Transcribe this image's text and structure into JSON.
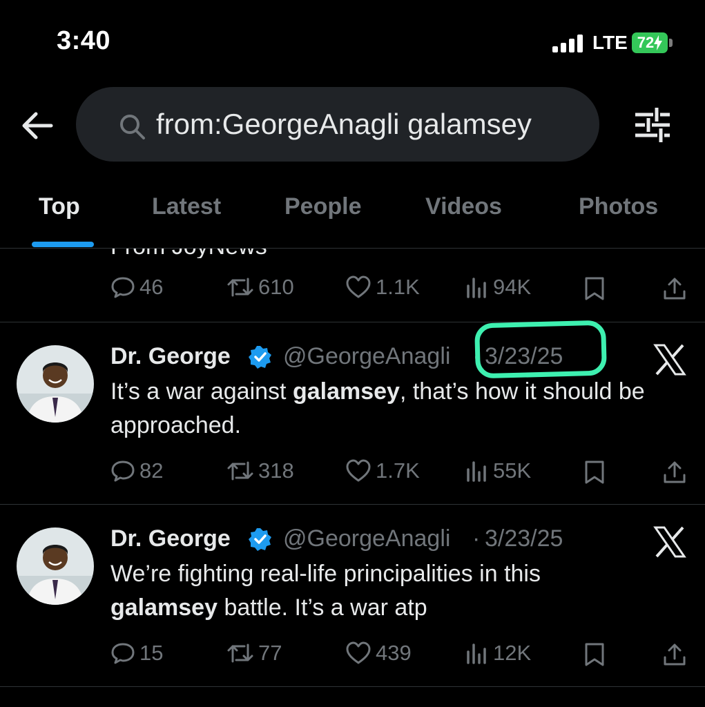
{
  "status_bar": {
    "time": "3:40",
    "network": "LTE",
    "battery": "72"
  },
  "header": {
    "back_icon": "arrow-left-icon",
    "search": {
      "icon": "search-icon",
      "query": "from:GeorgeAnagli galamsey"
    },
    "filter_icon": "sliders-icon"
  },
  "tabs": [
    {
      "label": "Top",
      "active": true
    },
    {
      "label": "Latest"
    },
    {
      "label": "People"
    },
    {
      "label": "Videos"
    },
    {
      "label": "Photos"
    }
  ],
  "prev_tweet": {
    "clipped_text": "From JoyNews",
    "stats": {
      "replies": "46",
      "reposts": "610",
      "likes": "1.1K",
      "views": "94K"
    }
  },
  "tweets": [
    {
      "name": "Dr. George",
      "handle": "@GeorgeAnagli",
      "separator": "·",
      "date": "3/23/25",
      "text_parts": [
        "It’s a war against ",
        "galamsey",
        ", that’s how it should be approached."
      ],
      "stats": {
        "replies": "82",
        "reposts": "318",
        "likes": "1.7K",
        "views": "55K"
      }
    },
    {
      "name": "Dr. George",
      "handle": "@GeorgeAnagli",
      "separator": "·",
      "date": "3/23/25",
      "text_parts": [
        "We’re fighting real-life principalities in this ",
        "galamsey",
        " battle. It’s a war atp"
      ],
      "stats": {
        "replies": "15",
        "reposts": "77",
        "likes": "439",
        "views": "12K"
      }
    }
  ],
  "colors": {
    "accent": "#1d9bf0",
    "highlight": "#3ef0b0",
    "muted": "#71767b",
    "battery": "#34c759"
  }
}
